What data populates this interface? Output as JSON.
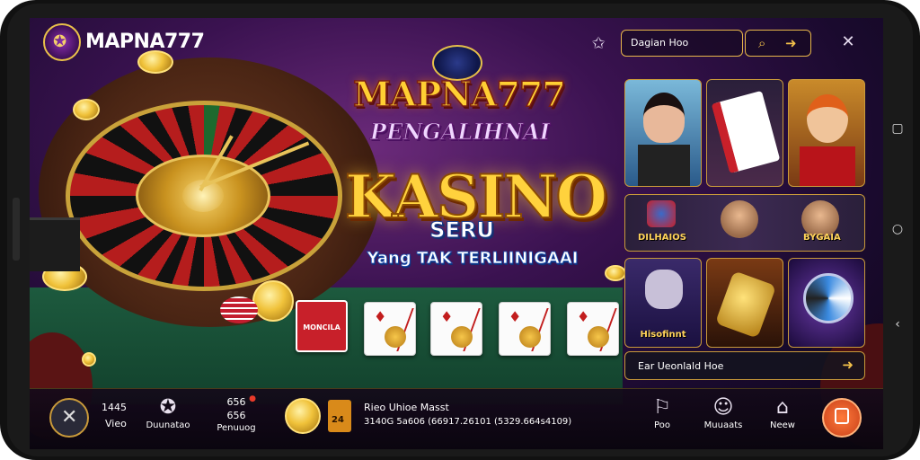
{
  "brand": {
    "name": "MAPNA777",
    "banner_name": "MAPNA777",
    "subtitle": "PENGALIHNAI"
  },
  "hero": {
    "headline": "KASINO",
    "sub": "SERU",
    "tagline": "Yang TAK TERLIINIGAAI"
  },
  "topbar": {
    "search_label": "Dagian Hoo"
  },
  "games": {
    "row2_left": "DILHAIOS",
    "row2_right": "BYGAIA",
    "row3_left": "Hisofinnt",
    "load_more": "Ear Ueonlald Hoe"
  },
  "bottom": {
    "item1_line1": "1445",
    "item1_line2": "Vieo",
    "item2_label": "Duunatao",
    "item3_line1": "656",
    "item3_line2": "656",
    "item3_label": "Penuuog",
    "item3_badge": "●",
    "rank_label": "24",
    "marquee_title": "Rieo Uhioe Masst",
    "marquee_text": "3140G 5a606 (66917.26101 (5329.664s4109)",
    "nav1": "Poo",
    "nav2": "Muuaats",
    "nav3": "Neew"
  },
  "colors": {
    "accent_gold": "#e7b64a",
    "brand_purple": "#3a1250",
    "felt_green": "#1d5a3e",
    "cta_orange": "#e8551c"
  },
  "icons": [
    "logo-emblem",
    "star-icon",
    "search-icon",
    "arrow-icon",
    "close-icon",
    "settings-icon",
    "medal-icon",
    "map-icon",
    "chat-icon",
    "gift-icon",
    "home-icon"
  ]
}
